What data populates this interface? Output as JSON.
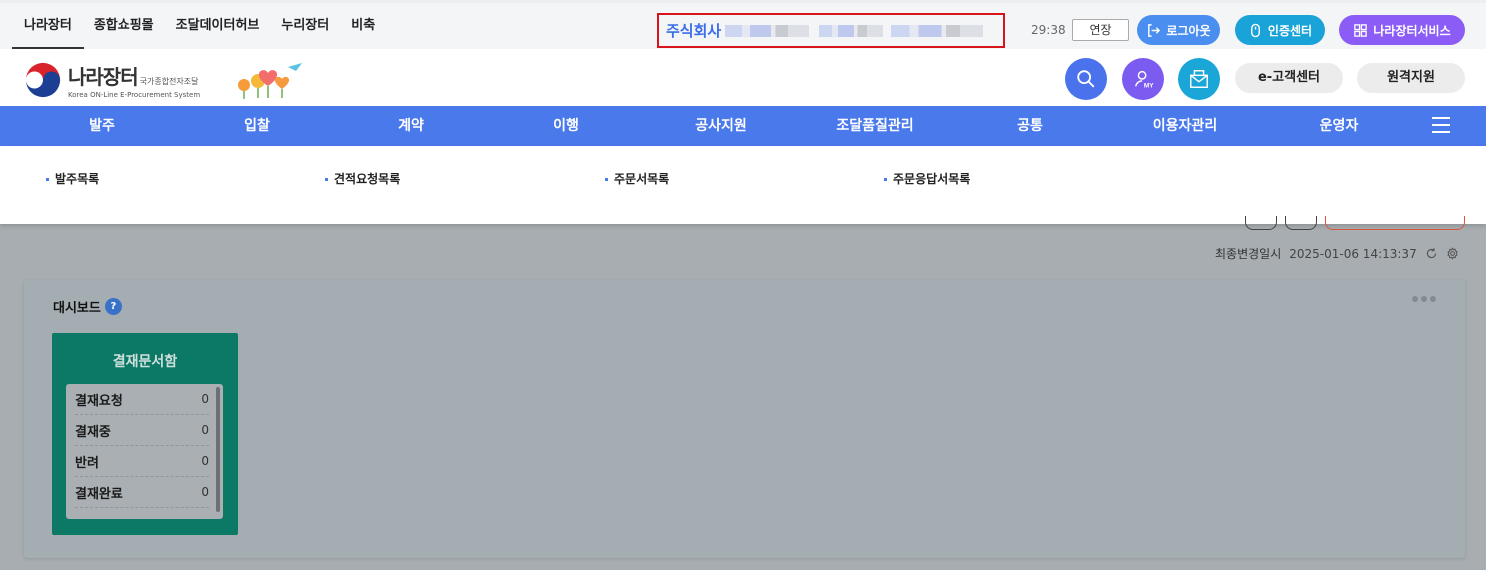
{
  "topnav": {
    "items": [
      "나라장터",
      "종합쇼핑몰",
      "조달데이터허브",
      "누리장터",
      "비축"
    ]
  },
  "session": {
    "company_name": "주식회사",
    "timer": "29:38",
    "extend_label": "연장",
    "logout_label": "로그아웃",
    "cert_label": "인증센터",
    "service_label": "나라장터서비스"
  },
  "header": {
    "logo_kor": "나라장터",
    "logo_kor_sub": "국가종합전자조달",
    "logo_eng": "Korea ON-Line E-Procurement System",
    "my_label": "MY",
    "help_label": "e-고객센터",
    "remote_label": "원격지원"
  },
  "mainnav": {
    "items": [
      "발주",
      "입찰",
      "계약",
      "이행",
      "공사지원",
      "조달품질관리",
      "공통",
      "이용자관리",
      "운영자"
    ]
  },
  "submenu": {
    "items": [
      "발주목록",
      "견적요청목록",
      "주문서목록",
      "주문응답서목록"
    ]
  },
  "updated": {
    "label": "최종변경일시",
    "value": "2025-01-06 14:13:37"
  },
  "dashboard": {
    "title": "대시보드",
    "help_glyph": "?",
    "widget": {
      "title": "결재문서함",
      "rows": [
        {
          "label": "결재요청",
          "count": "0"
        },
        {
          "label": "결재중",
          "count": "0"
        },
        {
          "label": "반려",
          "count": "0"
        },
        {
          "label": "결재완료",
          "count": "0"
        }
      ]
    }
  },
  "colors": {
    "nav_blue": "#4a79ec",
    "widget_teal": "#0c7866",
    "highlight_red": "#d7141a"
  }
}
